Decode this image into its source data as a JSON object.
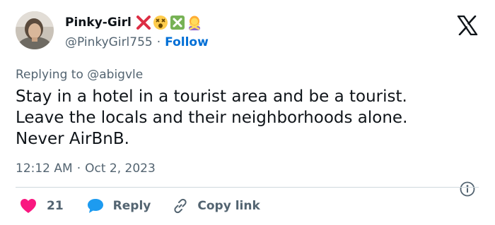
{
  "author": {
    "display_name": "Pinky-Girl",
    "name_emojis": [
      "cross-mark-emoji",
      "dizzy-face-emoji",
      "cross-mark-button-emoji",
      "person-gesturing-no-emoji"
    ],
    "handle": "@PinkyGirl755",
    "separator": "·",
    "follow_label": "Follow"
  },
  "reply_to": "Replying to @abigvle",
  "tweet": {
    "lines": [
      "Stay in a hotel in a tourist area and be a tourist.",
      "Leave the locals and their neighborhoods alone.",
      "Never AirBnB."
    ]
  },
  "meta": {
    "time": "12:12 AM",
    "separator": "·",
    "date": "Oct 2, 2023"
  },
  "actions": {
    "like_count": "21",
    "reply_label": "Reply",
    "copy_link_label": "Copy link"
  },
  "colors": {
    "text": "#0f1419",
    "secondary": "#536471",
    "link": "#006fd6",
    "heart": "#f91880",
    "reply_bubble": "#1d9bf0",
    "divider": "#cfd9de"
  },
  "icons": [
    "x-logo-icon",
    "info-icon",
    "heart-icon",
    "reply-bubble-icon",
    "link-icon"
  ]
}
